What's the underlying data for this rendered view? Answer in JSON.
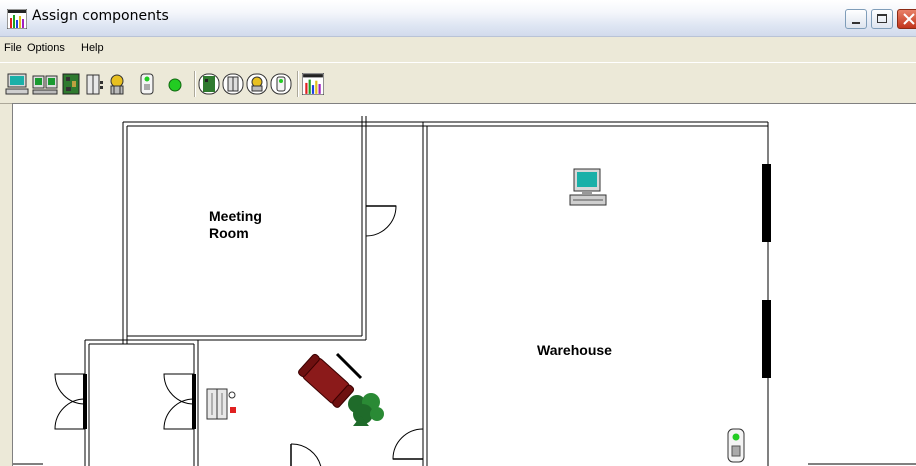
{
  "window": {
    "title": "Assign components",
    "app_icon": "rack-chart-icon",
    "controls": [
      "minimize-icon",
      "maximize-icon",
      "close-icon"
    ]
  },
  "menu": {
    "items": [
      "File",
      "Options",
      "Help"
    ]
  },
  "toolbar": {
    "buttons": [
      "computer-icon",
      "workstation-pair-icon",
      "circuit-board-icon",
      "elevator-door-icon",
      "tree-icon",
      "sensor-device-icon",
      "green-dot-icon",
      "board-group-icon",
      "door-group-icon",
      "tree-group-icon",
      "sensor-group-icon",
      "rack-chart-icon"
    ]
  },
  "floorplan": {
    "rooms": {
      "meeting_room": "Meeting\nRoom",
      "warehouse": "Warehouse"
    },
    "objects": [
      "computer-icon",
      "sofa-icon",
      "plant-icon",
      "elevator-icon",
      "sensor-device-icon"
    ]
  },
  "colors": {
    "title_gradient_top": "#ffffff",
    "title_gradient_bottom": "#d2dbec",
    "chrome": "#ece9d8",
    "close_button": "#c2351c",
    "sofa": "#8b1a1a",
    "plant": "#1f6b2a",
    "status_green": "#22cc22"
  }
}
